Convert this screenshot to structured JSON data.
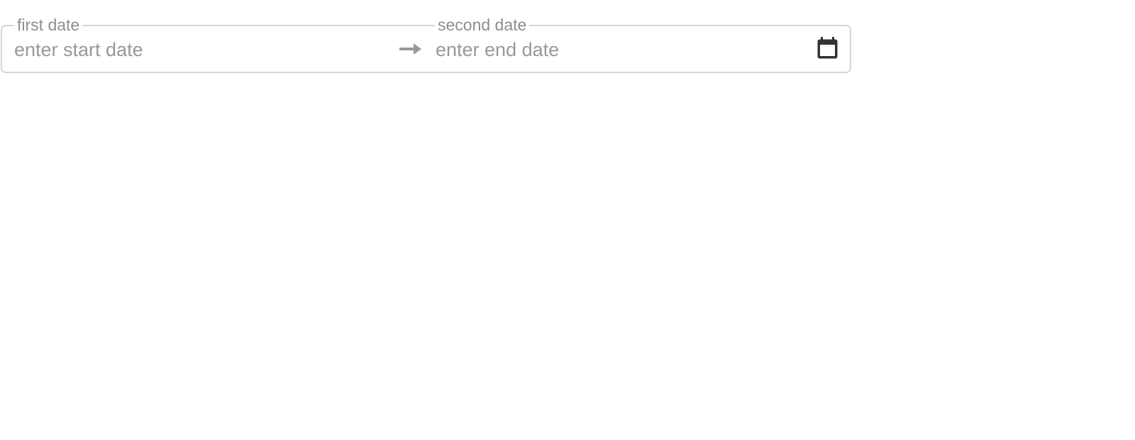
{
  "start": {
    "legend": "first date",
    "placeholder": "enter start date"
  },
  "end": {
    "legend": "second date",
    "placeholder": "enter end date"
  },
  "icons": {
    "separator": "arrow-right-icon",
    "picker": "calendar-icon"
  },
  "colors": {
    "border": "#d6d6d6",
    "legend_text": "#8e8e8e",
    "placeholder_text": "#999999",
    "icon_dark": "#333333"
  }
}
